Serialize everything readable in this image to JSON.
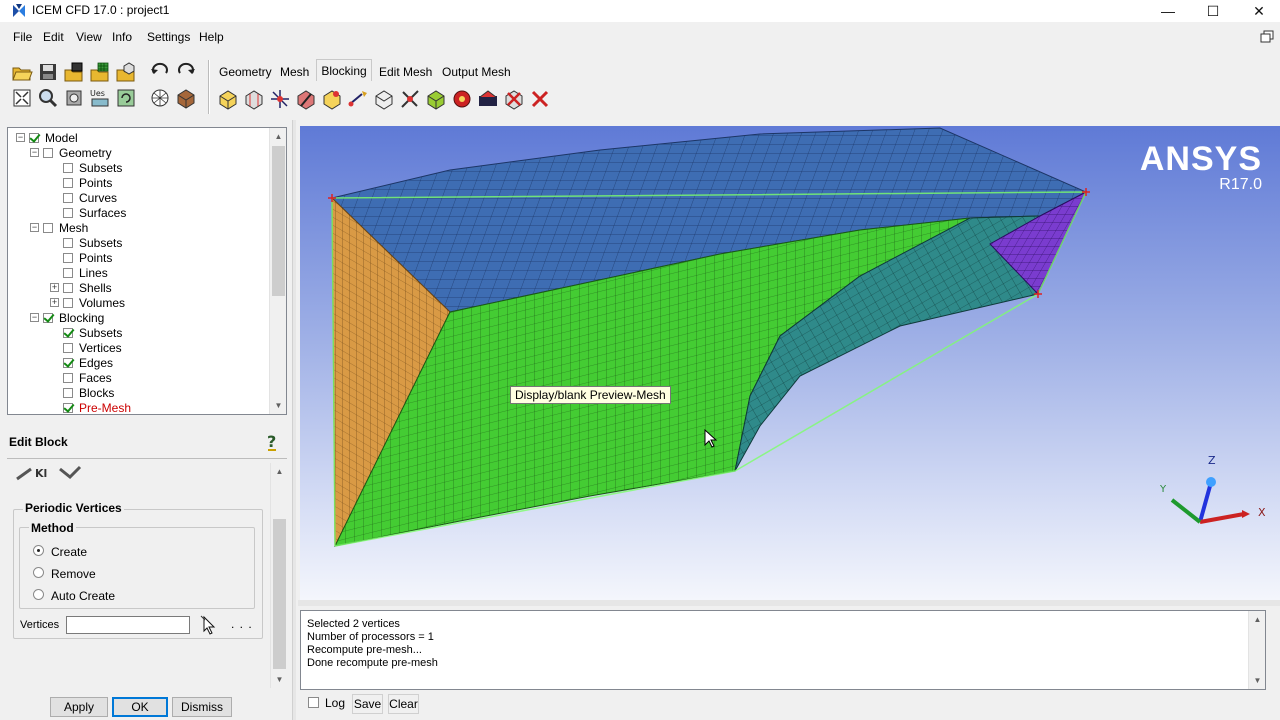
{
  "window": {
    "title": "ICEM CFD 17.0 : project1",
    "minimize_glyph": "—",
    "maximize_glyph": "☐",
    "close_glyph": "✕"
  },
  "menu": [
    "File",
    "Edit",
    "View",
    "Info",
    "Settings",
    "Help"
  ],
  "toolbar_tabs": [
    "Geometry",
    "Mesh",
    "Blocking",
    "Edit Mesh",
    "Output Mesh"
  ],
  "active_tab": "Blocking",
  "left_toolbar_icons": [
    "open-icon",
    "save-icon",
    "open-geometry-icon",
    "open-mesh-icon",
    "open-blocking-icon",
    "undo-icon",
    "redo-icon",
    "fit-window-icon",
    "zoom-icon",
    "measure-icon",
    "units-icon",
    "refresh-icon",
    "solid-view-icon",
    "shade-icon"
  ],
  "blocking_toolbar_icons": [
    "create-block-icon",
    "split-block-icon",
    "merge-vertices-icon",
    "edit-block-icon",
    "associate-icon",
    "move-vertex-icon",
    "transform-blocks-icon",
    "edit-edge-icon",
    "pre-mesh-params-icon",
    "pre-mesh-quality-icon",
    "check-blocks-icon",
    "delete-block-icon"
  ],
  "tree": {
    "items": [
      {
        "label": "Model",
        "level": 0,
        "expander": "−",
        "checked": true
      },
      {
        "label": "Geometry",
        "level": 1,
        "expander": "−",
        "checked": false
      },
      {
        "label": "Subsets",
        "level": 2,
        "checked": false
      },
      {
        "label": "Points",
        "level": 2,
        "checked": false
      },
      {
        "label": "Curves",
        "level": 2,
        "checked": false
      },
      {
        "label": "Surfaces",
        "level": 2,
        "checked": false
      },
      {
        "label": "Mesh",
        "level": 1,
        "expander": "−",
        "checked": false
      },
      {
        "label": "Subsets",
        "level": 2,
        "checked": false
      },
      {
        "label": "Points",
        "level": 2,
        "checked": false
      },
      {
        "label": "Lines",
        "level": 2,
        "checked": false
      },
      {
        "label": "Shells",
        "level": 2,
        "expander": "+",
        "checked": false
      },
      {
        "label": "Volumes",
        "level": 2,
        "expander": "+",
        "checked": false
      },
      {
        "label": "Blocking",
        "level": 1,
        "expander": "−",
        "checked": true
      },
      {
        "label": "Subsets",
        "level": 2,
        "checked": true
      },
      {
        "label": "Vertices",
        "level": 2,
        "checked": false
      },
      {
        "label": "Edges",
        "level": 2,
        "checked": true
      },
      {
        "label": "Faces",
        "level": 2,
        "checked": false
      },
      {
        "label": "Blocks",
        "level": 2,
        "checked": false
      },
      {
        "label": "Pre-Mesh",
        "level": 2,
        "checked": true,
        "color": "#cc0000"
      }
    ]
  },
  "edit_block": {
    "title": "Edit Block",
    "help_icon": "help-icon",
    "section_title": "Periodic Vertices",
    "method_label": "Method",
    "methods": [
      "Create",
      "Remove",
      "Auto Create"
    ],
    "selected_method": "Create",
    "vertices_label": "Vertices",
    "vertices_value": "",
    "more_label": ". . .",
    "apply_label": "Apply",
    "ok_label": "OK",
    "dismiss_label": "Dismiss"
  },
  "viewport": {
    "brand_name": "ANSYS",
    "brand_version": "R17.0",
    "tooltip": "Display/blank Preview-Mesh",
    "axes": {
      "x": "X",
      "y": "Y",
      "z": "Z"
    },
    "colors": {
      "green": "#44cc33",
      "blue": "#3e6db3",
      "orange": "#d99a45",
      "purple": "#7a3ccf",
      "teal": "#2f8a8a"
    }
  },
  "messages": {
    "lines": [
      "Selected 2 vertices",
      "Number of processors = 1",
      "Recompute pre-mesh...",
      "Done recompute pre-mesh"
    ],
    "log_label": "Log",
    "save_label": "Save",
    "clear_label": "Clear"
  }
}
